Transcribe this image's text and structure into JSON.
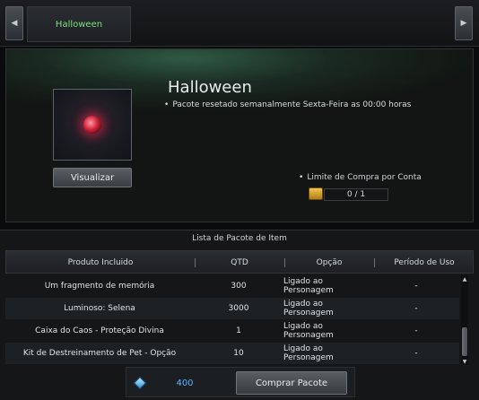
{
  "nav": {
    "prev_glyph": "◀",
    "next_glyph": "▶"
  },
  "tabs": [
    {
      "label": "Halloween",
      "active": true
    }
  ],
  "package": {
    "title": "Halloween",
    "reset_note": "Pacote resetado semanalmente Sexta-Feira as 00:00 horas",
    "view_label": "Visualizar",
    "limit_label": "Limite de Compra por Conta",
    "limit_value": "0 / 1",
    "icon": "red-gem-icon"
  },
  "item_list": {
    "title": "Lista de Pacote de Item",
    "columns": [
      "Produto Incluido",
      "QTD",
      "Opção",
      "Período de Uso"
    ],
    "rows": [
      {
        "product": "Um fragmento de memória",
        "qty": "300",
        "option": "Ligado ao Personagem",
        "period": "-"
      },
      {
        "product": "Luminoso: Selena",
        "qty": "3000",
        "option": "Ligado ao Personagem",
        "period": "-"
      },
      {
        "product": "Caixa do Caos - Proteção Divina",
        "qty": "1",
        "option": "Ligado ao Personagem",
        "period": "-"
      },
      {
        "product": "Kit de Destreinamento de Pet - Opção",
        "qty": "10",
        "option": "Ligado ao Personagem",
        "period": "-"
      }
    ]
  },
  "footer": {
    "currency_icon": "diamond-icon",
    "price": "400",
    "buy_label": "Comprar Pacote"
  },
  "colors": {
    "tab_text": "#7fe07f",
    "price": "#5ab0ff",
    "gem": "#d0243c"
  }
}
